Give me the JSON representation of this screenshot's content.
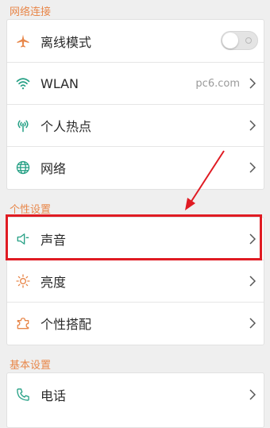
{
  "colors": {
    "accent": "#e8874a",
    "icon_green": "#26a085",
    "annotation_red": "#e01b23"
  },
  "sections": {
    "network": {
      "title": "网络连接",
      "items": [
        {
          "label": "离线模式",
          "icon": "airplane-icon",
          "control": "toggle",
          "toggle_on": false
        },
        {
          "label": "WLAN",
          "icon": "wifi-icon",
          "value": "pc6.com"
        },
        {
          "label": "个人热点",
          "icon": "hotspot-icon"
        },
        {
          "label": "网络",
          "icon": "globe-icon"
        }
      ]
    },
    "personal": {
      "title": "个性设置",
      "items": [
        {
          "label": "声音",
          "icon": "speaker-icon"
        },
        {
          "label": "亮度",
          "icon": "brightness-icon"
        },
        {
          "label": "个性搭配",
          "icon": "puzzle-icon"
        }
      ]
    },
    "basic": {
      "title": "基本设置",
      "items": [
        {
          "label": "电话",
          "icon": "phone-icon"
        }
      ]
    }
  }
}
